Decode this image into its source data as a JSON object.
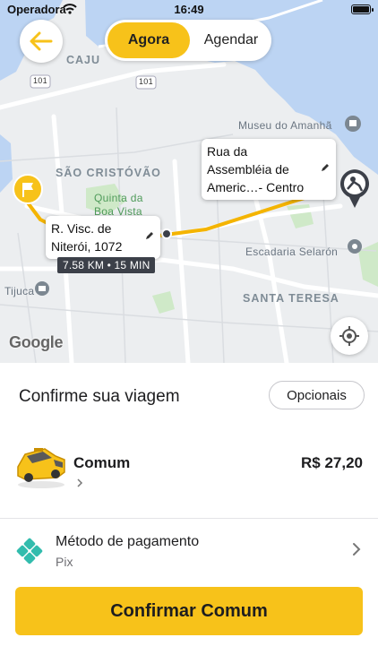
{
  "status_bar": {
    "carrier": "Operadora",
    "time": "16:49"
  },
  "header": {
    "segments": [
      {
        "label": "Agora",
        "active": true
      },
      {
        "label": "Agendar",
        "active": false
      }
    ]
  },
  "map": {
    "labels": {
      "caju": "CAJU",
      "sao_cristovao": "SÃO CRISTÓVÃO",
      "quinta": "Quinta da",
      "boa_vista": "Boa Vista",
      "tijuca": "Tijuca",
      "santa_teresa": "SANTA TERESA",
      "museu": "Museu do Amanhã",
      "escadaria": "Escadaria Selarón",
      "road_101_a": "101",
      "road_101_b": "101"
    },
    "origin_callout": {
      "line1": "R. Visc. de",
      "line2": "Niterói, 1072"
    },
    "destination_callout": {
      "line1": "Rua da",
      "line2": "Assembléia de",
      "line3": "Americ…- Centro"
    },
    "eta": "7.58 KM • 15 MIN",
    "attribution": "Google",
    "colors": {
      "water": "#bcd4f3",
      "route": "#f4b400",
      "park": "#cfe9c8",
      "land": "#eceef0"
    }
  },
  "sheet": {
    "title": "Confirme sua viagem",
    "options_label": "Opcionais",
    "ride": {
      "name": "Comum",
      "price": "R$ 27,20"
    },
    "payment": {
      "label": "Método de pagamento",
      "value": "Pix"
    },
    "confirm_label": "Confirmar Comum",
    "accent": "#f7c21a"
  }
}
